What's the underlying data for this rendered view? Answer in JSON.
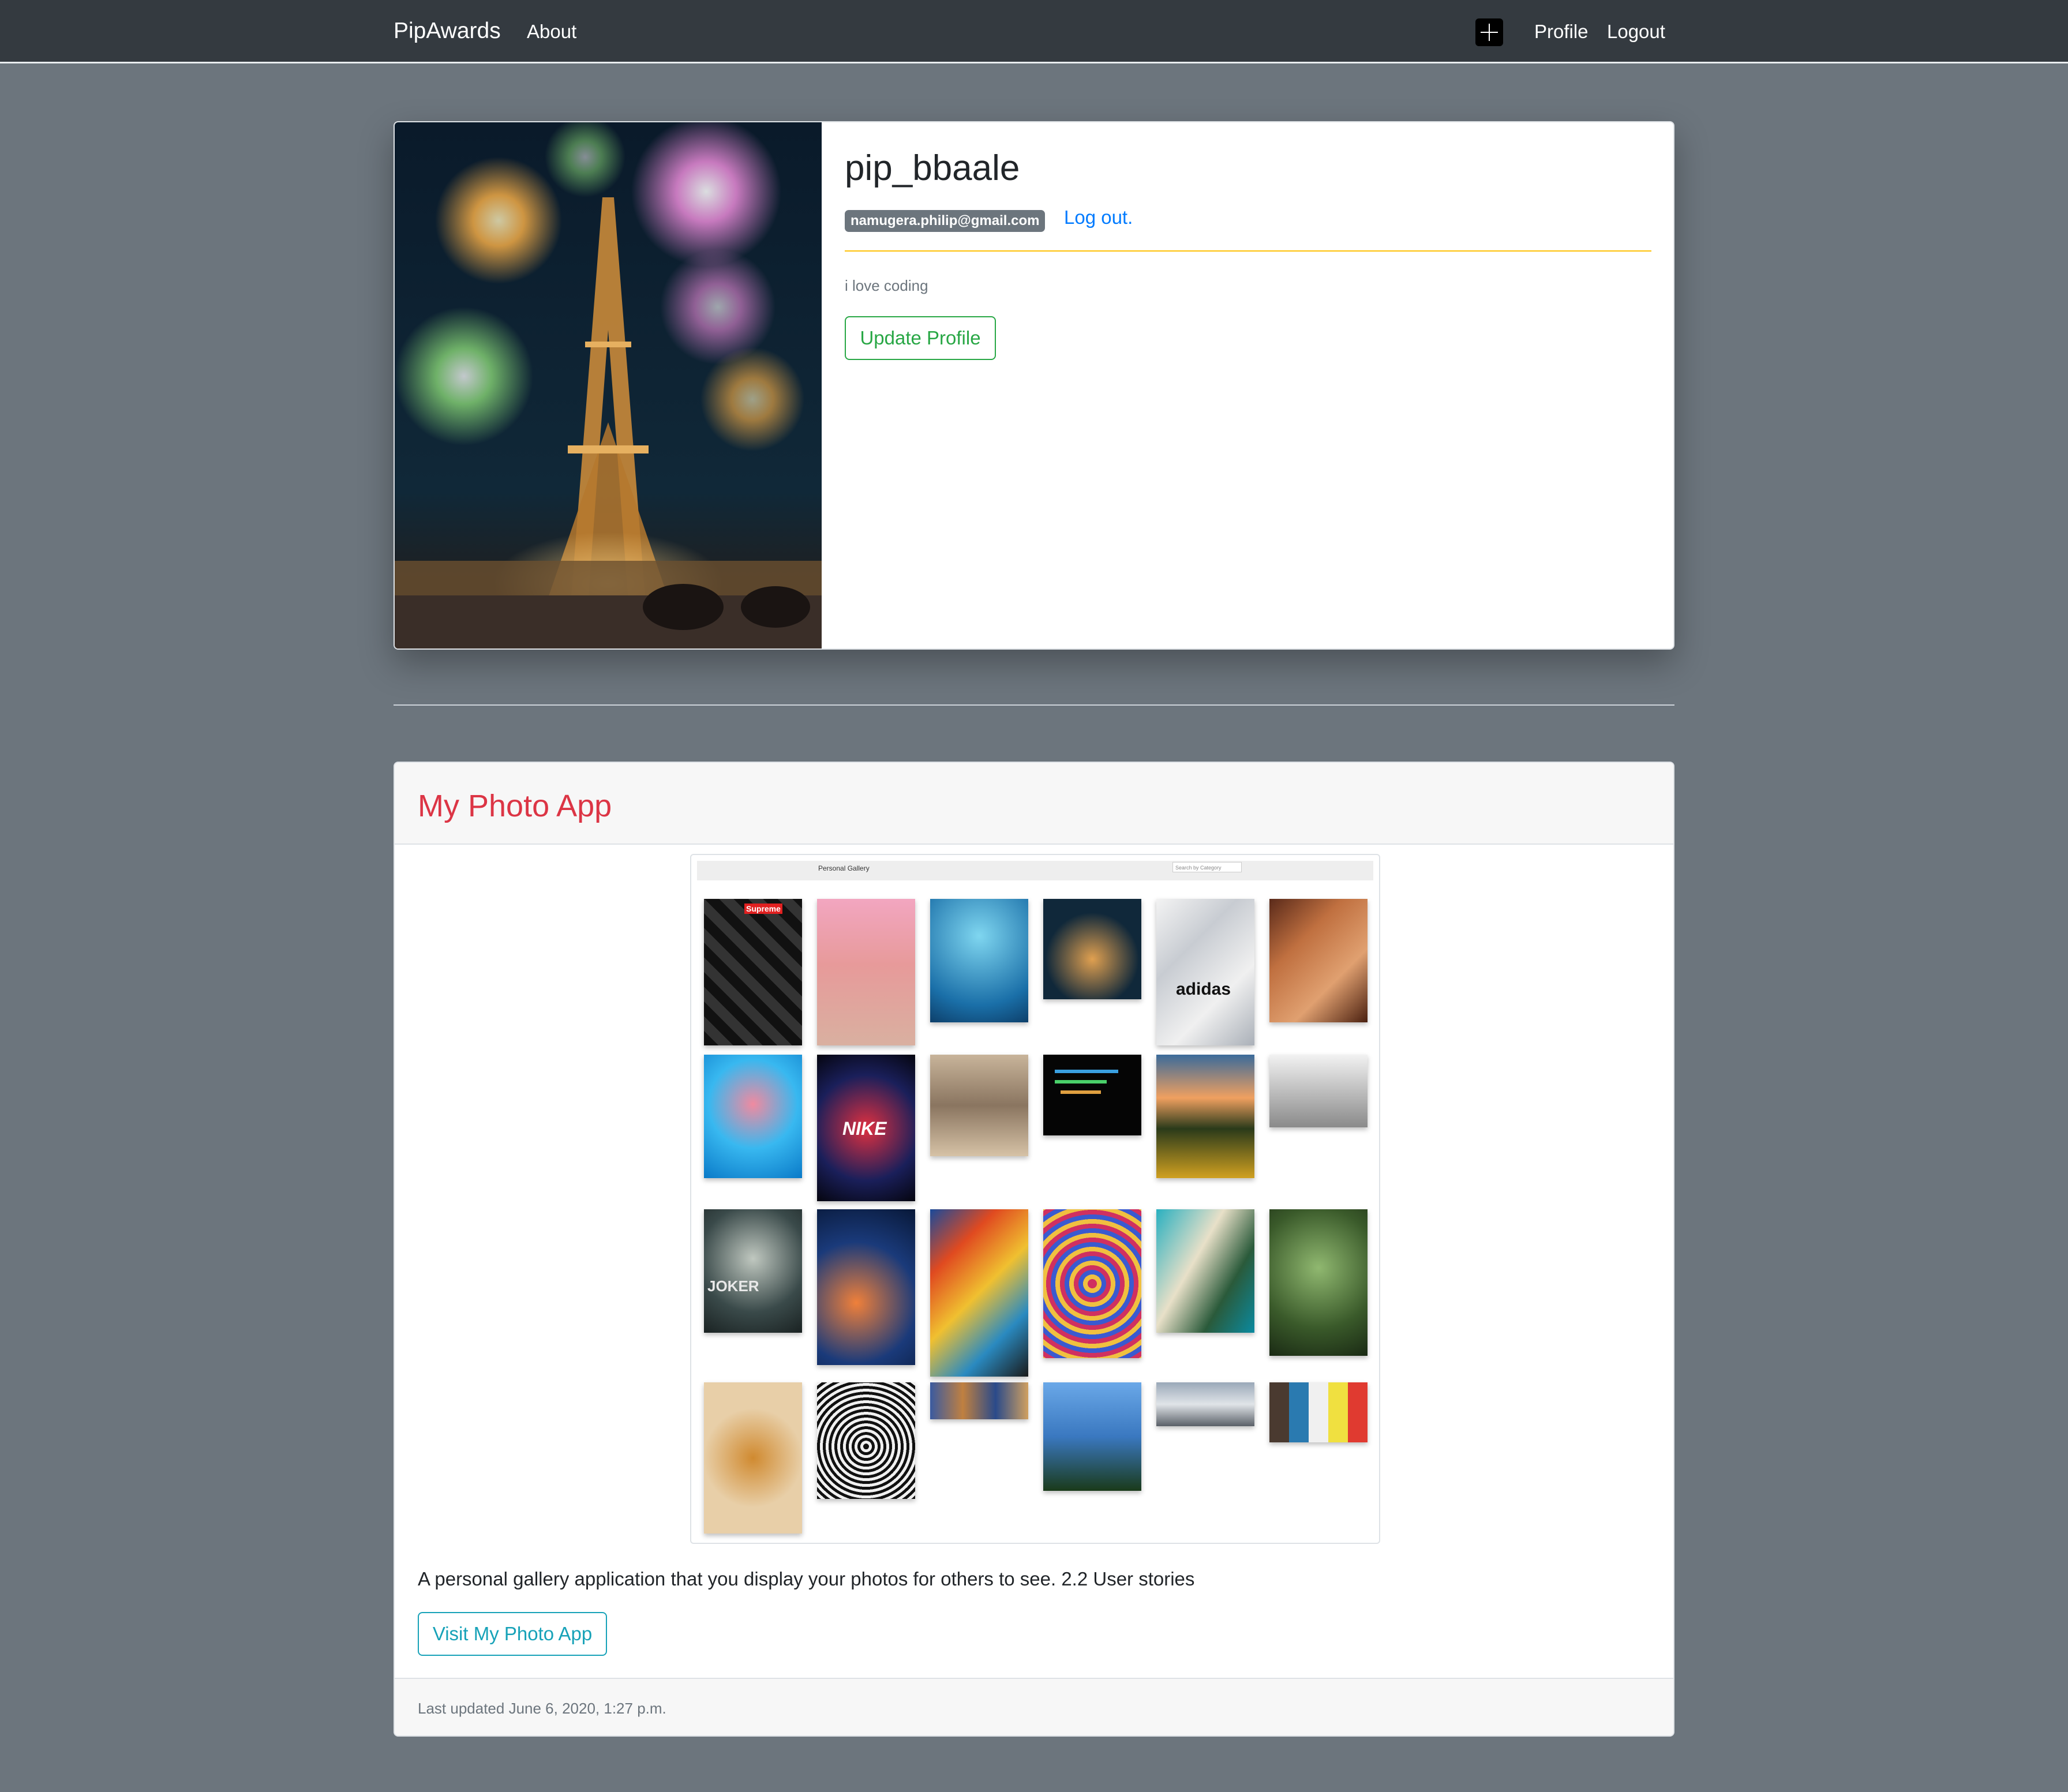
{
  "navbar": {
    "brand": "PipAwards",
    "about": "About",
    "add_icon": "plus-square-icon",
    "profile": "Profile",
    "logout": "Logout"
  },
  "profile": {
    "username": "pip_bbaale",
    "email": "namugera.philip@gmail.com",
    "logout_link": "Log out.",
    "bio": "i love coding",
    "update_button": "Update Profile",
    "image": "eiffel-tower-fireworks-photo"
  },
  "project": {
    "title": "My Photo App",
    "screenshot": {
      "header_title": "Personal Gallery",
      "search_placeholder": "Search by Category",
      "thumbnails": [
        {
          "label": "Supreme"
        },
        {
          "label": ""
        },
        {
          "label": ""
        },
        {
          "label": ""
        },
        {
          "label": "adidas"
        },
        {
          "label": ""
        },
        {
          "label": ""
        },
        {
          "label": "NIKE"
        },
        {
          "label": ""
        },
        {
          "label": ""
        },
        {
          "label": ""
        },
        {
          "label": ""
        },
        {
          "label": "JOKER"
        },
        {
          "label": ""
        },
        {
          "label": ""
        },
        {
          "label": ""
        },
        {
          "label": ""
        },
        {
          "label": ""
        },
        {
          "label": ""
        },
        {
          "label": ""
        },
        {
          "label": ""
        },
        {
          "label": ""
        },
        {
          "label": ""
        },
        {
          "label": ""
        }
      ]
    },
    "description": "A personal gallery application that you display your photos for others to see. 2.2 User stories",
    "visit_button": "Visit My Photo App",
    "last_updated": "Last updated June 6, 2020, 1:27 p.m."
  },
  "colors": {
    "page_bg": "#6c757d",
    "navbar_bg": "#343a40",
    "title_red": "#dc3545",
    "success": "#28a745",
    "info": "#17a2b8",
    "link": "#007bff",
    "rule_gold": "#ffc107"
  }
}
